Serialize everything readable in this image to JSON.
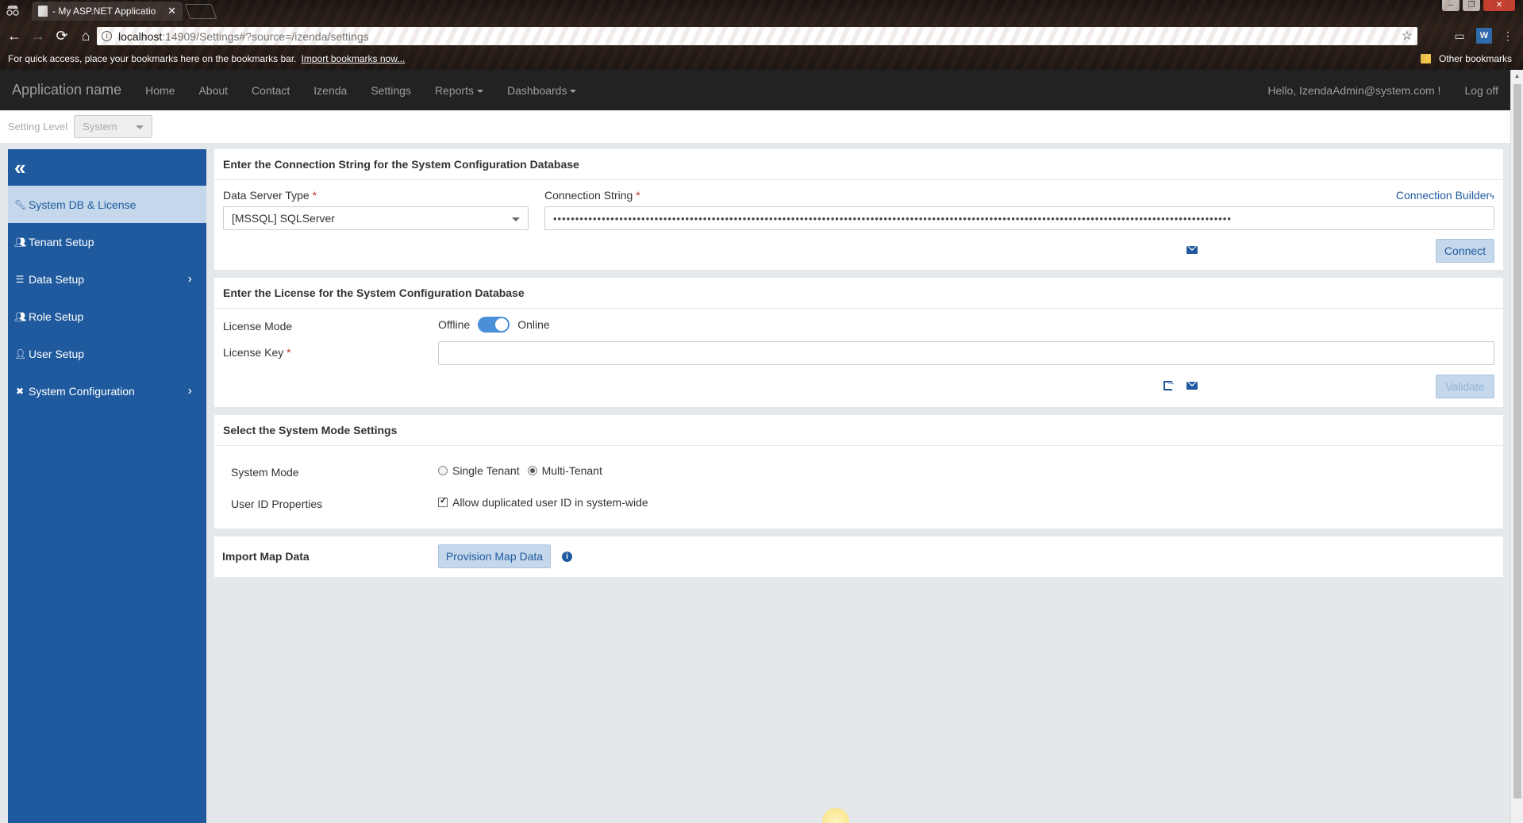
{
  "browser": {
    "tab_title": "- My ASP.NET Applicatio",
    "url_host": "localhost",
    "url_rest": ":14909/Settings#?source=/izenda/settings",
    "bookmarks_hint": "For quick access, place your bookmarks here on the bookmarks bar.",
    "import_link": "Import bookmarks now...",
    "other_bookmarks": "Other bookmarks"
  },
  "navbar": {
    "brand": "Application name",
    "items": [
      "Home",
      "About",
      "Contact",
      "Izenda",
      "Settings"
    ],
    "reports": "Reports",
    "dashboards": "Dashboards",
    "greeting": "Hello, IzendaAdmin@system.com !",
    "logoff": "Log off"
  },
  "setting_level": {
    "label": "Setting Level",
    "value": "System"
  },
  "sidebar": {
    "items": [
      {
        "label": "System DB & License",
        "icon": "wrench-icon",
        "active": true
      },
      {
        "label": "Tenant Setup",
        "icon": "users-icon"
      },
      {
        "label": "Data Setup",
        "icon": "data-setup-icon",
        "chevron": true
      },
      {
        "label": "Role Setup",
        "icon": "users-icon"
      },
      {
        "label": "User Setup",
        "icon": "user-icon"
      },
      {
        "label": "System Configuration",
        "icon": "tools-icon",
        "chevron": true
      }
    ]
  },
  "connection": {
    "title": "Enter the Connection String for the System Configuration Database",
    "server_type_label": "Data Server Type",
    "server_type_value": "[MSSQL] SQLServer",
    "conn_string_label": "Connection String",
    "builder": "Connection Builder",
    "masked_value": "••••••••••••••••••••••••••••••••••••••••••••••••••••••••••••••••••••••••••••••••••••••••••••••••••••••••••••••••••••••••••••••••••••••••••••••••••••••••••",
    "connect": "Connect"
  },
  "license": {
    "title": "Enter the License for the System Configuration Database",
    "mode_label": "License Mode",
    "offline": "Offline",
    "online": "Online",
    "key_label": "License Key",
    "validate": "Validate"
  },
  "system_mode": {
    "title": "Select the System Mode Settings",
    "mode_label": "System Mode",
    "single": "Single Tenant",
    "multi": "Multi-Tenant",
    "selected": "Multi-Tenant",
    "userid_label": "User ID Properties",
    "allow_dup": "Allow duplicated user ID in system-wide",
    "allow_dup_checked": true
  },
  "import_map": {
    "label": "Import Map Data",
    "button": "Provision Map Data"
  },
  "colors": {
    "sidebar": "#1f5a9e",
    "navbar": "#222222",
    "active_item": "#c5d8eb"
  }
}
